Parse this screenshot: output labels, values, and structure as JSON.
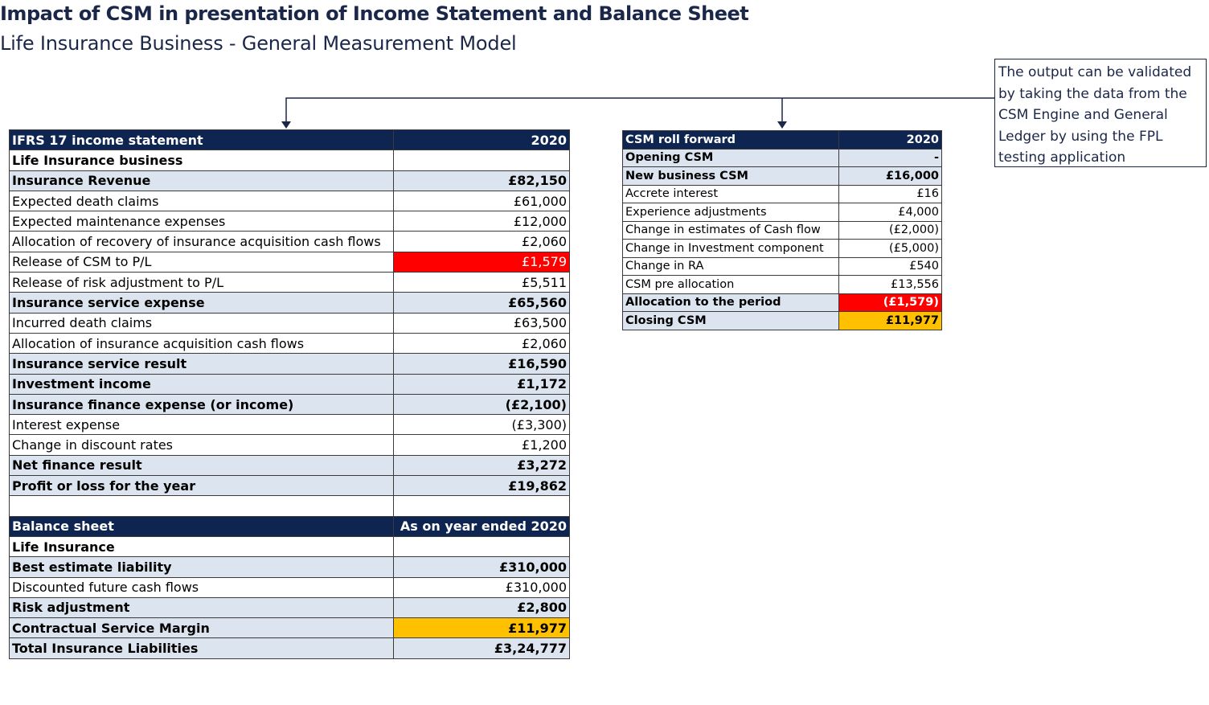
{
  "page": {
    "title": "Impact of CSM in presentation of Income Statement and Balance Sheet",
    "subtitle": "Life Insurance Business - General Measurement Model"
  },
  "note": {
    "text": "The output can be validated by taking the data from the CSM Engine and General Ledger by using the FPL testing application"
  },
  "income_statement": {
    "header": {
      "label": "IFRS 17 income statement",
      "value": "2020"
    },
    "rows": [
      {
        "label": "Life Insurance business",
        "value": "",
        "style": "bold"
      },
      {
        "label": "Insurance Revenue",
        "value": "£82,150",
        "style": "alt"
      },
      {
        "label": "Expected death claims",
        "value": "£61,000",
        "style": ""
      },
      {
        "label": "Expected maintenance expenses",
        "value": "£12,000",
        "style": ""
      },
      {
        "label": "Allocation of recovery of insurance acquisition cash flows",
        "value": "£2,060",
        "style": ""
      },
      {
        "label": "Release of CSM to P/L",
        "value": "£1,579",
        "style": "",
        "highlight": "red"
      },
      {
        "label": "Release of risk adjustment to P/L",
        "value": "£5,511",
        "style": ""
      },
      {
        "label": "Insurance service expense",
        "value": "£65,560",
        "style": "alt"
      },
      {
        "label": "Incurred death claims",
        "value": "£63,500",
        "style": ""
      },
      {
        "label": "Allocation of insurance acquisition cash flows",
        "value": "£2,060",
        "style": ""
      },
      {
        "label": "Insurance service result",
        "value": "£16,590",
        "style": "alt"
      },
      {
        "label": "Investment income",
        "value": "£1,172",
        "style": "alt"
      },
      {
        "label": "Insurance finance expense (or income)",
        "value": "(£2,100)",
        "style": "alt"
      },
      {
        "label": "Interest expense",
        "value": "(£3,300)",
        "style": ""
      },
      {
        "label": "Change in discount rates",
        "value": "£1,200",
        "style": ""
      },
      {
        "label": "Net finance result",
        "value": "£3,272",
        "style": "alt"
      },
      {
        "label": "Profit or loss for the year",
        "value": "£19,862",
        "style": "alt"
      },
      {
        "label": "",
        "value": "",
        "style": ""
      }
    ]
  },
  "balance_sheet": {
    "header": {
      "label": "Balance sheet",
      "value": "As on year ended 2020"
    },
    "rows": [
      {
        "label": "Life Insurance",
        "value": "",
        "style": "bold"
      },
      {
        "label": "Best estimate liability",
        "value": "£310,000",
        "style": "alt"
      },
      {
        "label": "Discounted future cash flows",
        "value": "£310,000",
        "style": ""
      },
      {
        "label": "Risk adjustment",
        "value": "£2,800",
        "style": "alt"
      },
      {
        "label": "Contractual Service Margin",
        "value": "£11,977",
        "style": "alt",
        "highlight": "amber"
      },
      {
        "label": "Total Insurance Liabilities",
        "value": "£3,24,777",
        "style": "alt"
      }
    ]
  },
  "csm_roll_forward": {
    "header": {
      "label": "CSM roll forward",
      "value": "2020"
    },
    "rows": [
      {
        "label": "Opening CSM",
        "value": "-",
        "style": "alt"
      },
      {
        "label": "New business CSM",
        "value": "£16,000",
        "style": "alt"
      },
      {
        "label": "Accrete interest",
        "value": "£16",
        "style": ""
      },
      {
        "label": "Experience adjustments",
        "value": "£4,000",
        "style": ""
      },
      {
        "label": "Change in estimates of Cash flow",
        "value": "(£2,000)",
        "style": ""
      },
      {
        "label": "Change in Investment component",
        "value": "(£5,000)",
        "style": ""
      },
      {
        "label": "Change in RA",
        "value": "£540",
        "style": ""
      },
      {
        "label": "CSM pre allocation",
        "value": "£13,556",
        "style": ""
      },
      {
        "label": "Allocation to the period",
        "value": "(£1,579)",
        "style": "alt",
        "highlight": "red"
      },
      {
        "label": "Closing CSM",
        "value": "£11,977",
        "style": "alt",
        "highlight": "amber"
      }
    ]
  }
}
